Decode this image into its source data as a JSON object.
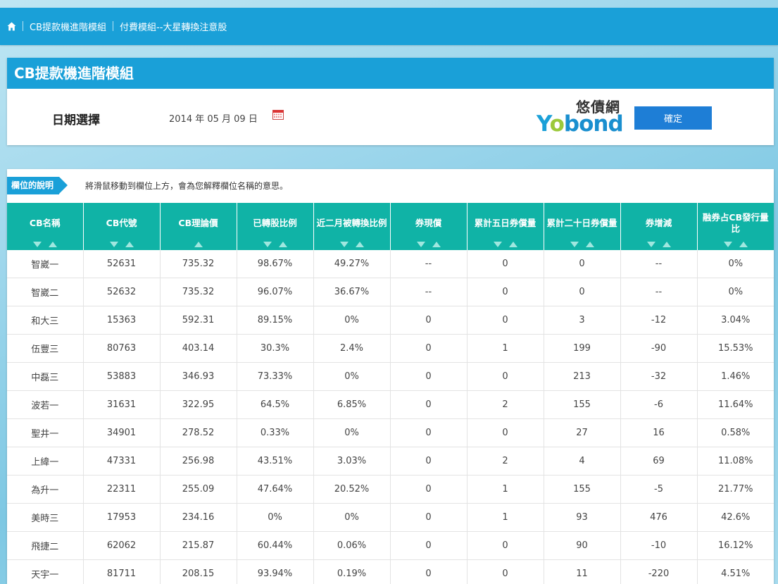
{
  "breadcrumb": {
    "items": [
      "CB提款機進階模組",
      "付費模組--大星轉換注意股"
    ]
  },
  "panel": {
    "title": "CB提款機進階模組",
    "date_label": "日期選擇",
    "date_value": "2014 年 05 月 09 日",
    "logo_zh": "悠債網",
    "logo_en_y": "Y",
    "logo_en_o": "o",
    "logo_en_rest": "bond",
    "confirm_label": "確定"
  },
  "legend": {
    "tag": "欄位的說明",
    "description": "將滑鼠移動到欄位上方，會為您解釋欄位名稱的意思。"
  },
  "columns": [
    "CB名稱",
    "CB代號",
    "CB理論價",
    "已轉股比例",
    "近二月被轉換比例",
    "券現償",
    "累計五日券償量",
    "累計二十日券償量",
    "券增減",
    "融券占CB發行量比"
  ],
  "rows": [
    [
      "智崴一",
      "52631",
      "735.32",
      "98.67%",
      "49.27%",
      "--",
      "0",
      "0",
      "--",
      "0%"
    ],
    [
      "智崴二",
      "52632",
      "735.32",
      "96.07%",
      "36.67%",
      "--",
      "0",
      "0",
      "--",
      "0%"
    ],
    [
      "和大三",
      "15363",
      "592.31",
      "89.15%",
      "0%",
      "0",
      "0",
      "3",
      "-12",
      "3.04%"
    ],
    [
      "伍豐三",
      "80763",
      "403.14",
      "30.3%",
      "2.4%",
      "0",
      "1",
      "199",
      "-90",
      "15.53%"
    ],
    [
      "中磊三",
      "53883",
      "346.93",
      "73.33%",
      "0%",
      "0",
      "0",
      "213",
      "-32",
      "1.46%"
    ],
    [
      "波若一",
      "31631",
      "322.95",
      "64.5%",
      "6.85%",
      "0",
      "2",
      "155",
      "-6",
      "11.64%"
    ],
    [
      "聖井一",
      "34901",
      "278.52",
      "0.33%",
      "0%",
      "0",
      "0",
      "27",
      "16",
      "0.58%"
    ],
    [
      "上緯一",
      "47331",
      "256.98",
      "43.51%",
      "3.03%",
      "0",
      "2",
      "4",
      "69",
      "11.08%"
    ],
    [
      "為升一",
      "22311",
      "255.09",
      "47.64%",
      "20.52%",
      "0",
      "1",
      "155",
      "-5",
      "21.77%"
    ],
    [
      "美時三",
      "17953",
      "234.16",
      "0%",
      "0%",
      "0",
      "1",
      "93",
      "476",
      "42.6%"
    ],
    [
      "飛捷二",
      "62062",
      "215.87",
      "60.44%",
      "0.06%",
      "0",
      "0",
      "90",
      "-10",
      "16.12%"
    ],
    [
      "天宇一",
      "81711",
      "208.15",
      "93.94%",
      "0.19%",
      "0",
      "0",
      "11",
      "-220",
      "4.51%"
    ]
  ],
  "colors": {
    "brand_blue": "#1aa0d8",
    "header_teal": "#10b3a6",
    "button_blue": "#1e7ed6"
  }
}
